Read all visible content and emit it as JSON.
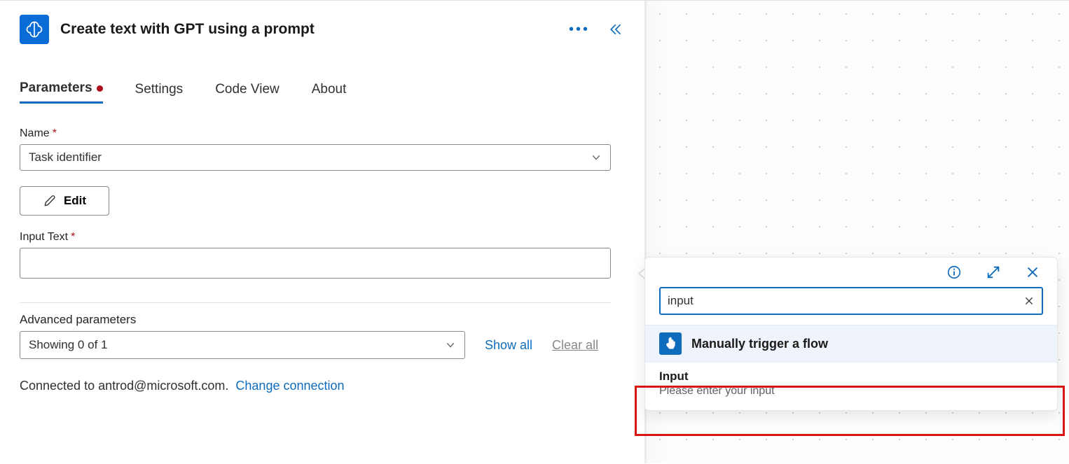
{
  "panel": {
    "title": "Create text with GPT using a prompt",
    "tabs": [
      "Parameters",
      "Settings",
      "Code View",
      "About"
    ],
    "activeTab": 0
  },
  "fields": {
    "name_label": "Name",
    "name_value": "Task identifier",
    "edit_label": "Edit",
    "input_text_label": "Input Text",
    "input_text_value": ""
  },
  "advanced": {
    "label": "Advanced parameters",
    "select_text": "Showing 0 of 1",
    "show_all": "Show all",
    "clear_all": "Clear all"
  },
  "connection": {
    "text": "Connected to antrod@microsoft.com.",
    "link": "Change connection"
  },
  "flyout": {
    "search_value": "input",
    "category_title": "Manually trigger a flow",
    "item_title": "Input",
    "item_desc": "Please enter your input"
  }
}
